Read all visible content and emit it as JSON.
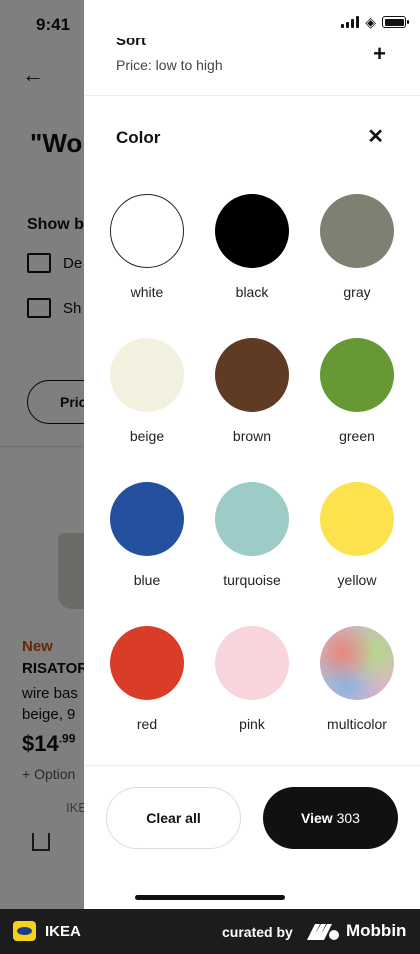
{
  "status": {
    "time": "9:41"
  },
  "background": {
    "heading": "\"Wo",
    "show_by": "Show b",
    "option_1": "De",
    "option_2": "Sh",
    "pill": "Pric",
    "product_badge": "New",
    "product_name": "RISATOR",
    "product_desc": "wire bas beige, 9",
    "price_whole": "$14",
    "price_cents": ".99",
    "options": "+ Option",
    "collection": "IKE"
  },
  "sort": {
    "title": "Sort",
    "value": "Price: low to high",
    "expand_icon": "plus-icon"
  },
  "color_section": {
    "title": "Color",
    "close_icon": "close-icon",
    "swatches": [
      {
        "label": "white",
        "color": "#ffffff"
      },
      {
        "label": "black",
        "color": "#000000"
      },
      {
        "label": "gray",
        "color": "#7f7f72"
      },
      {
        "label": "beige",
        "color": "#f2f1df"
      },
      {
        "label": "brown",
        "color": "#5e3b22"
      },
      {
        "label": "green",
        "color": "#669933"
      },
      {
        "label": "blue",
        "color": "#24509e"
      },
      {
        "label": "turquoise",
        "color": "#9ccbc8"
      },
      {
        "label": "yellow",
        "color": "#fce34e"
      },
      {
        "label": "red",
        "color": "#d93c27"
      },
      {
        "label": "pink",
        "color": "#f8d4dc"
      },
      {
        "label": "multicolor",
        "color": "gradient"
      }
    ]
  },
  "actions": {
    "clear_label": "Clear all",
    "view_label": "View",
    "view_count": "303"
  },
  "brand_bar": {
    "app_name": "IKEA",
    "curated_by": "curated by",
    "mobbin": "Mobbin"
  }
}
